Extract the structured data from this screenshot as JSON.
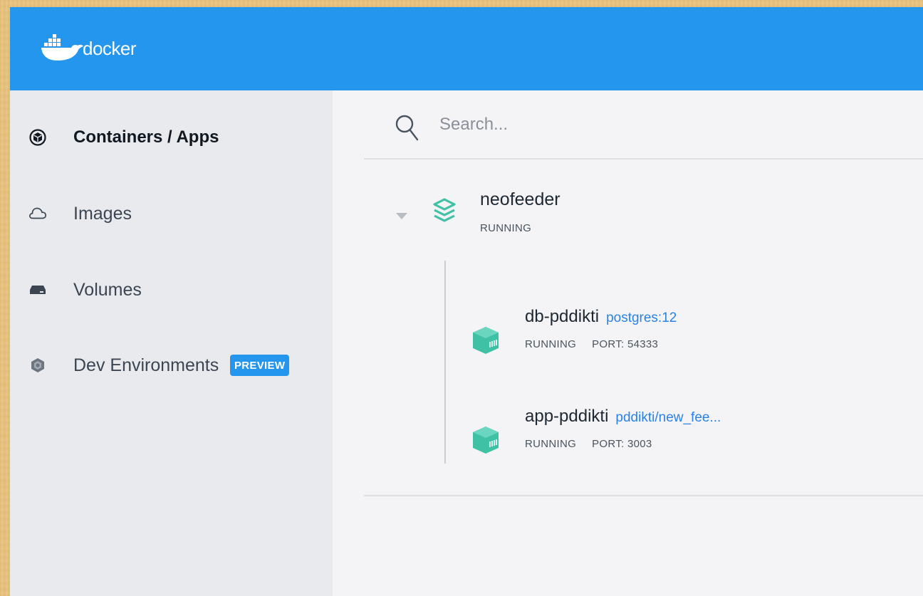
{
  "header": {
    "logo_text": "docker",
    "brand_color": "#2496ed"
  },
  "sidebar": {
    "items": [
      {
        "label": "Containers / Apps",
        "icon": "containers-icon",
        "active": true
      },
      {
        "label": "Images",
        "icon": "cloud-icon",
        "active": false
      },
      {
        "label": "Volumes",
        "icon": "drive-icon",
        "active": false
      },
      {
        "label": "Dev Environments",
        "icon": "dev-env-icon",
        "active": false,
        "badge": "PREVIEW"
      }
    ]
  },
  "search": {
    "placeholder": "Search...",
    "value": ""
  },
  "apps": [
    {
      "name": "neofeeder",
      "status": "RUNNING",
      "icon": "stack-icon",
      "icon_color": "#3fc1a5",
      "expanded": true,
      "containers": [
        {
          "name": "db-pddikti",
          "image": "postgres:12",
          "status": "RUNNING",
          "port": "PORT: 54333",
          "icon": "container-cube-icon"
        },
        {
          "name": "app-pddikti",
          "image": "pddikti/new_fee...",
          "status": "RUNNING",
          "port": "PORT: 3003",
          "icon": "container-cube-icon"
        }
      ]
    }
  ]
}
